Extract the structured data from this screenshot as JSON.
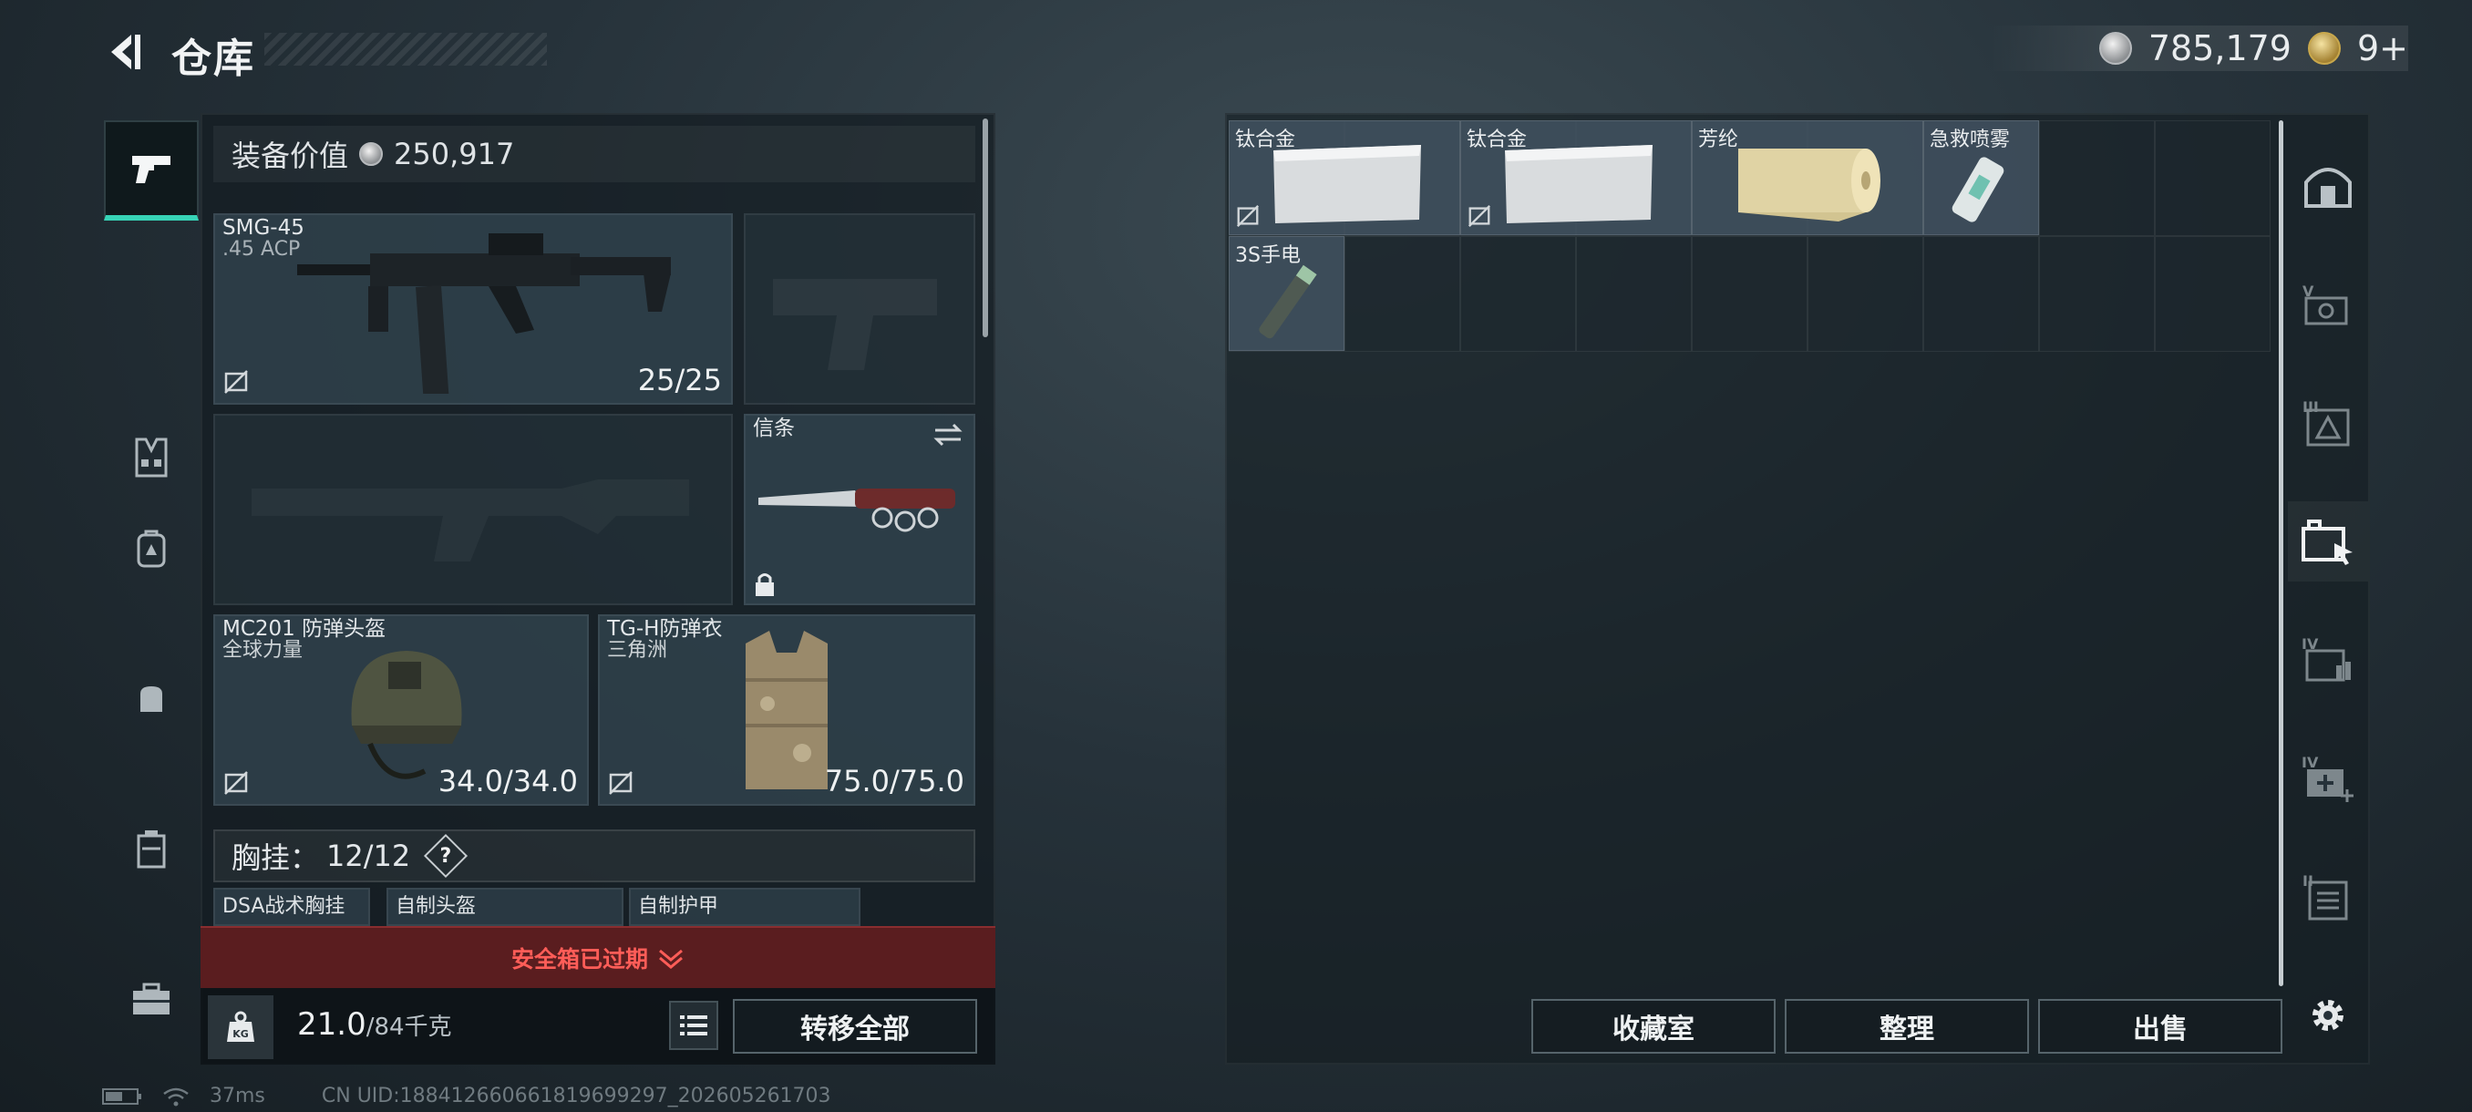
{
  "header": {
    "title": "仓库",
    "currency_coins": "785,179",
    "currency_tokens": "9+"
  },
  "equipment": {
    "value_label": "装备价值",
    "value_amount": "250,917",
    "primary_weapon": {
      "name": "SMG-45",
      "ammo_type": ".45 ACP",
      "ammo": "25/25"
    },
    "melee": {
      "name": "信条"
    },
    "helmet": {
      "name": "MC201 防弹头盔",
      "brand": "全球力量",
      "durability": "34.0/34.0"
    },
    "armor": {
      "name": "TG-H防弹衣",
      "brand": "三角洲",
      "durability": "75.0/75.0"
    },
    "chest_rig": {
      "label": "胸挂：",
      "count": "12/12",
      "help": "?"
    },
    "mini_slots": [
      "DSA战术胸挂",
      "自制头盔",
      "自制护甲"
    ],
    "safe_box": "安全箱已过期",
    "weight_current": "21.0",
    "weight_max": "/84千克",
    "transfer_all": "转移全部"
  },
  "storage": {
    "items": [
      {
        "name": "钛合金"
      },
      {
        "name": "钛合金"
      },
      {
        "name": "芳纶"
      },
      {
        "name": "急救喷雾"
      },
      {
        "name": "3S手电"
      }
    ],
    "buttons": {
      "collection": "收藏室",
      "organize": "整理",
      "sell": "出售"
    }
  },
  "status": {
    "ping": "37ms",
    "uid": "CN UID:188412660661819699297_202605261703"
  },
  "colors": {
    "accent": "#37d3b6",
    "danger": "#ff5d58",
    "safe_bg": "#5a1d1f"
  }
}
